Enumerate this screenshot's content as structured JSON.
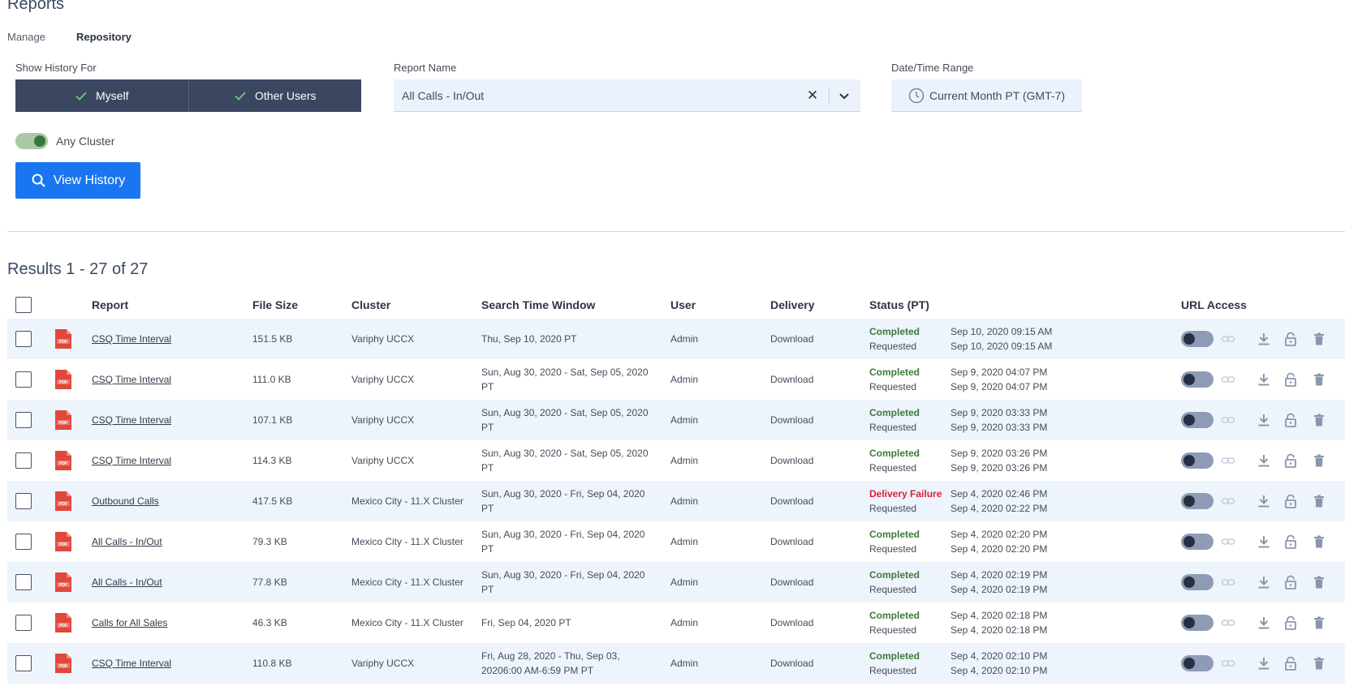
{
  "page": {
    "title": "Reports",
    "tabs": [
      "Manage",
      "Repository"
    ],
    "active_tab": "Repository"
  },
  "filters": {
    "show_history_label": "Show History For",
    "myself_label": "Myself",
    "other_users_label": "Other Users",
    "report_name_label": "Report Name",
    "report_name_value": "All Calls - In/Out",
    "date_range_label": "Date/Time Range",
    "date_range_value": "Current Month PT (GMT-7)",
    "cluster_toggle_label": "Any Cluster",
    "view_history_label": "View History"
  },
  "results": {
    "summary": "Results 1 - 27 of 27",
    "columns": {
      "report": "Report",
      "file_size": "File Size",
      "cluster": "Cluster",
      "search_window": "Search Time Window",
      "user": "User",
      "delivery": "Delivery",
      "status": "Status (PT)",
      "url_access": "URL Access"
    },
    "rows": [
      {
        "report": "CSQ Time Interval",
        "file_size": "151.5 KB",
        "cluster": "Variphy UCCX",
        "window": "Thu, Sep 10, 2020 PT",
        "user": "Admin",
        "delivery": "Download",
        "status": "Completed",
        "status_type": "ok",
        "requested": "Requested",
        "time1": "Sep 10, 2020 09:15 AM",
        "time2": "Sep 10, 2020 09:15 AM"
      },
      {
        "report": "CSQ Time Interval",
        "file_size": "111.0 KB",
        "cluster": "Variphy UCCX",
        "window": "Sun, Aug 30, 2020 - Sat, Sep 05, 2020 PT",
        "user": "Admin",
        "delivery": "Download",
        "status": "Completed",
        "status_type": "ok",
        "requested": "Requested",
        "time1": "Sep 9, 2020 04:07 PM",
        "time2": "Sep 9, 2020 04:07 PM"
      },
      {
        "report": "CSQ Time Interval",
        "file_size": "107.1 KB",
        "cluster": "Variphy UCCX",
        "window": "Sun, Aug 30, 2020 - Sat, Sep 05, 2020 PT",
        "user": "Admin",
        "delivery": "Download",
        "status": "Completed",
        "status_type": "ok",
        "requested": "Requested",
        "time1": "Sep 9, 2020 03:33 PM",
        "time2": "Sep 9, 2020 03:33 PM"
      },
      {
        "report": "CSQ Time Interval",
        "file_size": "114.3 KB",
        "cluster": "Variphy UCCX",
        "window": "Sun, Aug 30, 2020 - Sat, Sep 05, 2020 PT",
        "user": "Admin",
        "delivery": "Download",
        "status": "Completed",
        "status_type": "ok",
        "requested": "Requested",
        "time1": "Sep 9, 2020 03:26 PM",
        "time2": "Sep 9, 2020 03:26 PM"
      },
      {
        "report": "Outbound Calls",
        "file_size": "417.5 KB",
        "cluster": "Mexico City - 11.X Cluster",
        "window": "Sun, Aug 30, 2020 - Fri, Sep 04, 2020 PT",
        "user": "Admin",
        "delivery": "Download",
        "status": "Delivery Failure",
        "status_type": "fail",
        "requested": "Requested",
        "time1": "Sep 4, 2020 02:46 PM",
        "time2": "Sep 4, 2020 02:22 PM"
      },
      {
        "report": "All Calls - In/Out",
        "file_size": "79.3 KB",
        "cluster": "Mexico City - 11.X Cluster",
        "window": "Sun, Aug 30, 2020 - Fri, Sep 04, 2020 PT",
        "user": "Admin",
        "delivery": "Download",
        "status": "Completed",
        "status_type": "ok",
        "requested": "Requested",
        "time1": "Sep 4, 2020 02:20 PM",
        "time2": "Sep 4, 2020 02:20 PM"
      },
      {
        "report": "All Calls - In/Out",
        "file_size": "77.8 KB",
        "cluster": "Mexico City - 11.X Cluster",
        "window": "Sun, Aug 30, 2020 - Fri, Sep 04, 2020 PT",
        "user": "Admin",
        "delivery": "Download",
        "status": "Completed",
        "status_type": "ok",
        "requested": "Requested",
        "time1": "Sep 4, 2020 02:19 PM",
        "time2": "Sep 4, 2020 02:19 PM"
      },
      {
        "report": "Calls for All Sales",
        "file_size": "46.3 KB",
        "cluster": "Mexico City - 11.X Cluster",
        "window": "Fri, Sep 04, 2020 PT",
        "user": "Admin",
        "delivery": "Download",
        "status": "Completed",
        "status_type": "ok",
        "requested": "Requested",
        "time1": "Sep 4, 2020 02:18 PM",
        "time2": "Sep 4, 2020 02:18 PM"
      },
      {
        "report": "CSQ Time Interval",
        "file_size": "110.8 KB",
        "cluster": "Variphy UCCX",
        "window": "Fri, Aug 28, 2020 - Thu, Sep 03, 20206:00 AM-6:59 PM PT",
        "user": "Admin",
        "delivery": "Download",
        "status": "Completed",
        "status_type": "ok",
        "requested": "Requested",
        "time1": "Sep 4, 2020 02:10 PM",
        "time2": "Sep 4, 2020 02:10 PM"
      }
    ]
  },
  "colors": {
    "primary": "#1976f0",
    "segment_bg": "#3b4760",
    "completed": "#3d7a3a",
    "failure": "#d8213a",
    "row_alt": "#eef4fb",
    "pdf_red": "#e0483c"
  },
  "icons": {
    "check": "check-icon",
    "clear": "clear-icon",
    "chevron": "chevron-down-icon",
    "clock": "clock-icon",
    "search": "search-icon",
    "pdf": "pdf-file-icon",
    "link": "link-icon",
    "download": "download-icon",
    "lock": "lock-icon",
    "trash": "trash-icon"
  }
}
